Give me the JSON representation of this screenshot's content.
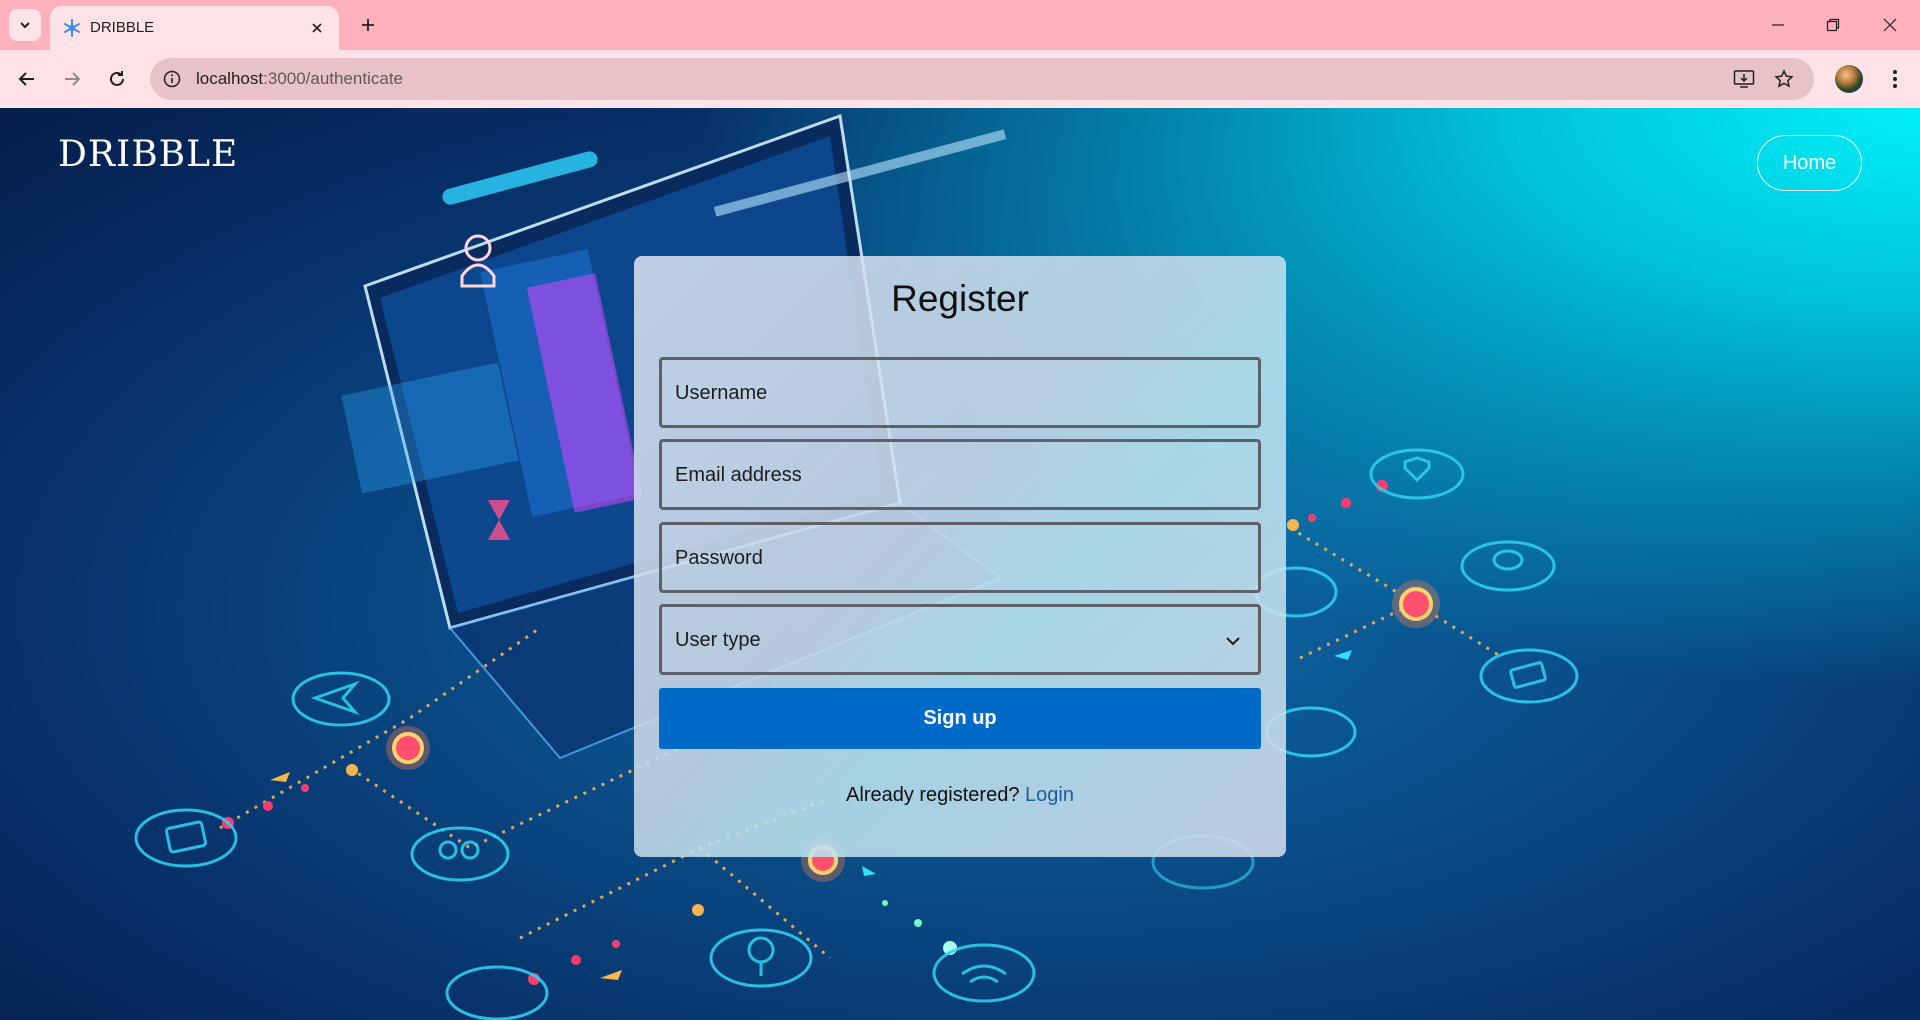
{
  "browser": {
    "tab_title": "DRIBBLE",
    "url_host": "localhost",
    "url_path": ":3000/authenticate"
  },
  "header": {
    "brand": "DRIBBLE",
    "home_label": "Home"
  },
  "form": {
    "title": "Register",
    "username_placeholder": "Username",
    "email_placeholder": "Email address",
    "password_placeholder": "Password",
    "user_type_placeholder": "User type",
    "submit_label": "Sign up",
    "already_text": "Already registered?",
    "login_label": "Login"
  },
  "colors": {
    "tabbar": "#ffb0bd",
    "toolbar": "#ffe3e8",
    "accent_button": "#006ac8",
    "link": "#1d5f98"
  }
}
